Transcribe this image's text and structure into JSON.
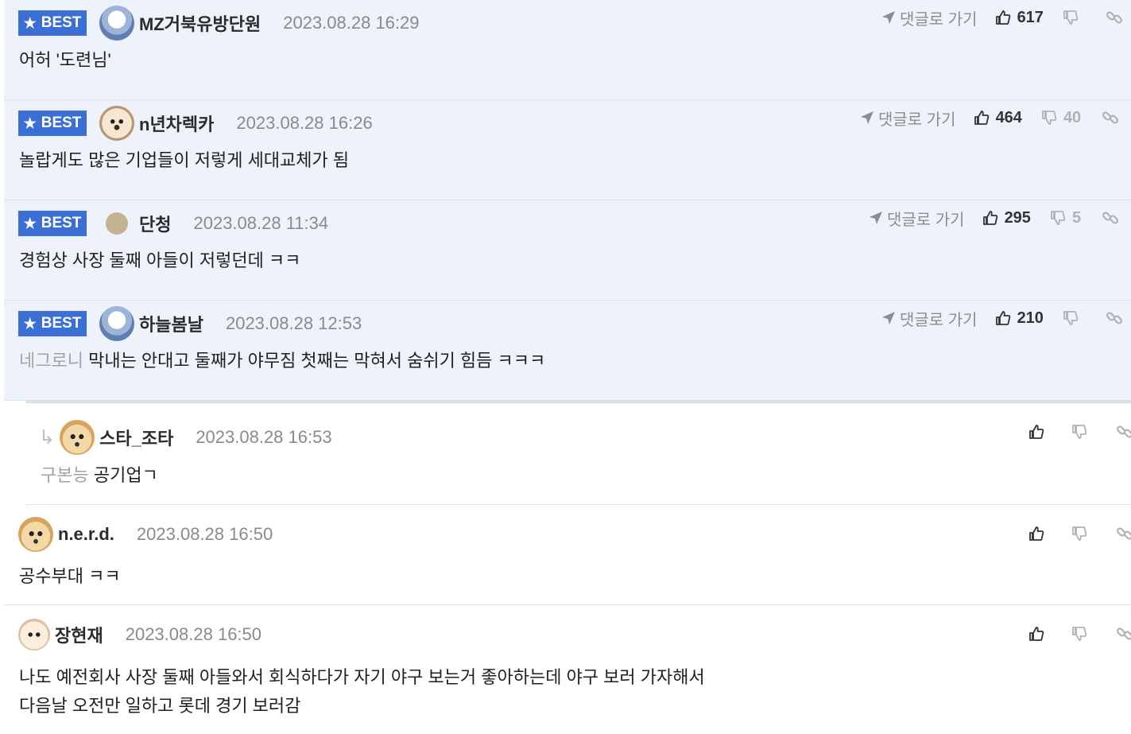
{
  "best_label": "BEST",
  "reply_to_label": "댓글로 가기",
  "comments": [
    {
      "nick": "MZ거북유방단원",
      "time": "2023.08.28 16:29",
      "text": "어허 '도련님'",
      "up": "617",
      "down": ""
    },
    {
      "nick": "n년차렉카",
      "time": "2023.08.28 16:26",
      "text": "놀랍게도 많은 기업들이 저렇게 세대교체가 됨",
      "up": "464",
      "down": "40"
    },
    {
      "nick": "단청",
      "time": "2023.08.28 11:34",
      "text": "경험상 사장 둘째 아들이 저렇던데 ㅋㅋ",
      "up": "295",
      "down": "5"
    },
    {
      "nick": "하늘봄날",
      "time": "2023.08.28 12:53",
      "mention": "네그로니",
      "text": "막내는 안대고 둘째가 야무짐 첫째는 막혀서 숨쉬기 힘듬 ㅋㅋㅋ",
      "up": "210",
      "down": ""
    },
    {
      "nick": "스타_조타",
      "time": "2023.08.28 16:53",
      "mention": "구본능",
      "text": "공기업ㄱ"
    },
    {
      "nick": "n.e.r.d.",
      "time": "2023.08.28 16:50",
      "text": "공수부대 ㅋㅋ"
    },
    {
      "nick": "장현재",
      "time": "2023.08.28 16:50",
      "text_line1": "나도 예전회사 사장 둘째 아들와서 회식하다가 자기 야구 보는거 좋아하는데 야구 보러 가자해서",
      "text_line2": "다음날 오전만 일하고 롯데 경기 보러감"
    }
  ],
  "accent_color": "#3b6fd6",
  "best_bg_color": "#eef3fb"
}
